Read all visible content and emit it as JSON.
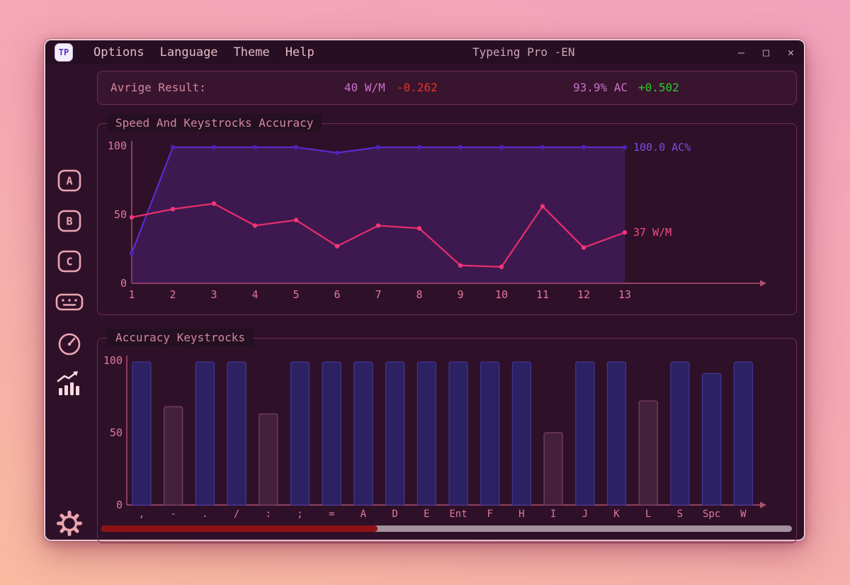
{
  "window": {
    "title": "Typeing Pro -EN",
    "logo_text": "TP",
    "menus": [
      {
        "label": "Options"
      },
      {
        "label": "Language"
      },
      {
        "label": "Theme"
      },
      {
        "label": "Help"
      }
    ],
    "controls": {
      "minimize": "–",
      "maximize": "□",
      "close": "✕"
    }
  },
  "result_bar": {
    "label": "Avrige Result:",
    "wpm_value": "40 W/M",
    "wpm_delta": "-0.262",
    "accuracy_value": "93.9% AC",
    "accuracy_delta": "+0.502"
  },
  "sidebar": {
    "items": [
      {
        "name": "layout-a",
        "label": "A"
      },
      {
        "name": "layout-b",
        "label": "B"
      },
      {
        "name": "layout-c",
        "label": "C"
      },
      {
        "name": "keyboard"
      },
      {
        "name": "speed-test"
      },
      {
        "name": "statistics",
        "active": true
      },
      {
        "name": "settings"
      }
    ]
  },
  "progress": {
    "percent": 40
  },
  "chart_data": [
    {
      "type": "line",
      "title": "Speed And Keystrocks Accuracy",
      "x": [
        1,
        2,
        3,
        4,
        5,
        6,
        7,
        8,
        9,
        10,
        11,
        12,
        13
      ],
      "series": [
        {
          "name": "AC%",
          "values": [
            22,
            99,
            99,
            99,
            99,
            95,
            99,
            99,
            99,
            99,
            99,
            99,
            99
          ],
          "color": "#5a2ccf",
          "dot_color": "#4a25b4",
          "end_label": "100.0 AC%",
          "end_label_color": "#7a4be0",
          "filled": true
        },
        {
          "name": "W/M",
          "values": [
            48,
            54,
            58,
            42,
            46,
            27,
            42,
            40,
            13,
            12,
            56,
            26,
            37
          ],
          "color": "#e72e6d",
          "dot_color": "#f2357c",
          "end_label": "37 W/M",
          "end_label_color": "#ef4d86",
          "filled": false
        }
      ],
      "ylim": [
        0,
        100
      ],
      "yticks": [
        0,
        50,
        100
      ],
      "area_fill": "rgba(98,47,170,0.30)",
      "axis_color": "#b2516f",
      "tick_color": "#e0789a",
      "grid": false,
      "legend_position": "none"
    },
    {
      "type": "bar",
      "title": "Accuracy Keystrocks",
      "categories": [
        ",",
        "-",
        ".",
        "/",
        ":",
        ";",
        "=",
        "A",
        "D",
        "E",
        "Ent",
        "F",
        "H",
        "I",
        "J",
        "K",
        "L",
        "S",
        "Spc",
        "W"
      ],
      "values": [
        99,
        68,
        99,
        99,
        63,
        99,
        99,
        99,
        99,
        99,
        99,
        99,
        99,
        50,
        99,
        99,
        72,
        99,
        91,
        99
      ],
      "ylim": [
        0,
        100
      ],
      "yticks": [
        0,
        50,
        100
      ],
      "low_threshold": 85,
      "colors": {
        "high_fill": "#2b2163",
        "high_stroke": "#453693",
        "low_fill": "#44203c",
        "low_stroke": "#7c4263"
      },
      "axis_color": "#b2516f",
      "tick_color": "#e0789a",
      "grid": false
    }
  ]
}
